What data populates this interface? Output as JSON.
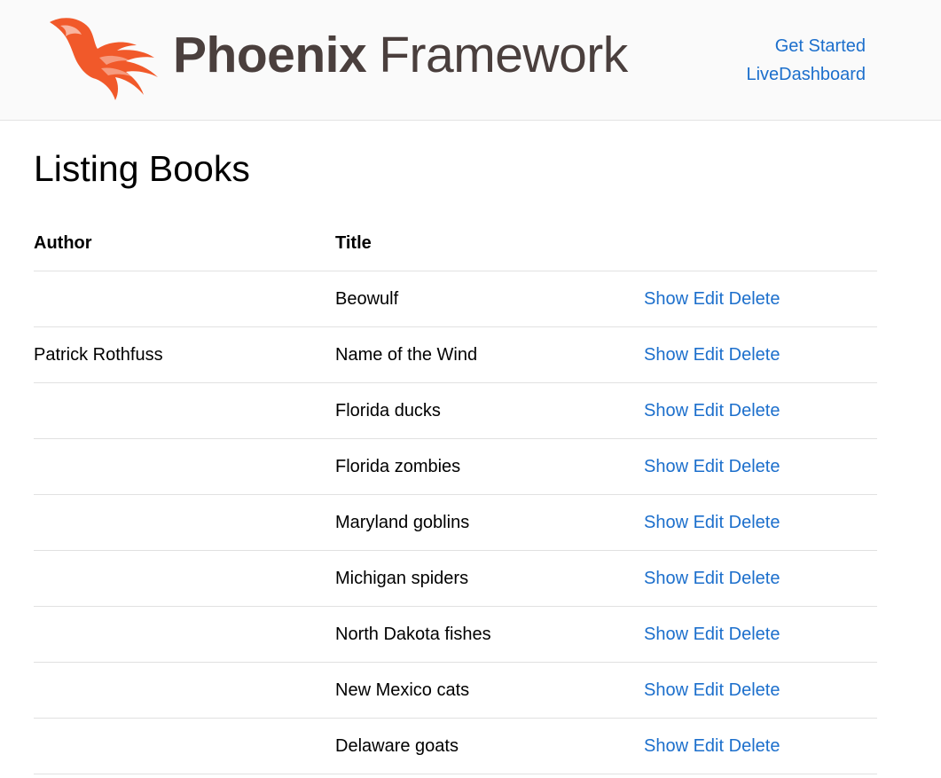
{
  "header": {
    "logo": {
      "brand_bold": "Phoenix",
      "brand_light": "Framework"
    },
    "nav": {
      "get_started": "Get Started",
      "live_dashboard": "LiveDashboard"
    },
    "colors": {
      "link": "#1c6fcc",
      "logo_orange": "#f1592a",
      "logo_text": "#4a3f3d",
      "header_bg": "#fafafa"
    }
  },
  "main": {
    "title": "Listing Books",
    "table": {
      "columns": [
        "Author",
        "Title",
        ""
      ],
      "rows": [
        {
          "author": "",
          "title": "Beowulf"
        },
        {
          "author": "Patrick Rothfuss",
          "title": "Name of the Wind"
        },
        {
          "author": "",
          "title": "Florida ducks"
        },
        {
          "author": "",
          "title": "Florida zombies"
        },
        {
          "author": "",
          "title": "Maryland goblins"
        },
        {
          "author": "",
          "title": "Michigan spiders"
        },
        {
          "author": "",
          "title": "North Dakota fishes"
        },
        {
          "author": "",
          "title": "New Mexico cats"
        },
        {
          "author": "",
          "title": "Delaware goats"
        }
      ],
      "actions": {
        "show": "Show",
        "edit": "Edit",
        "delete": "Delete"
      }
    }
  }
}
